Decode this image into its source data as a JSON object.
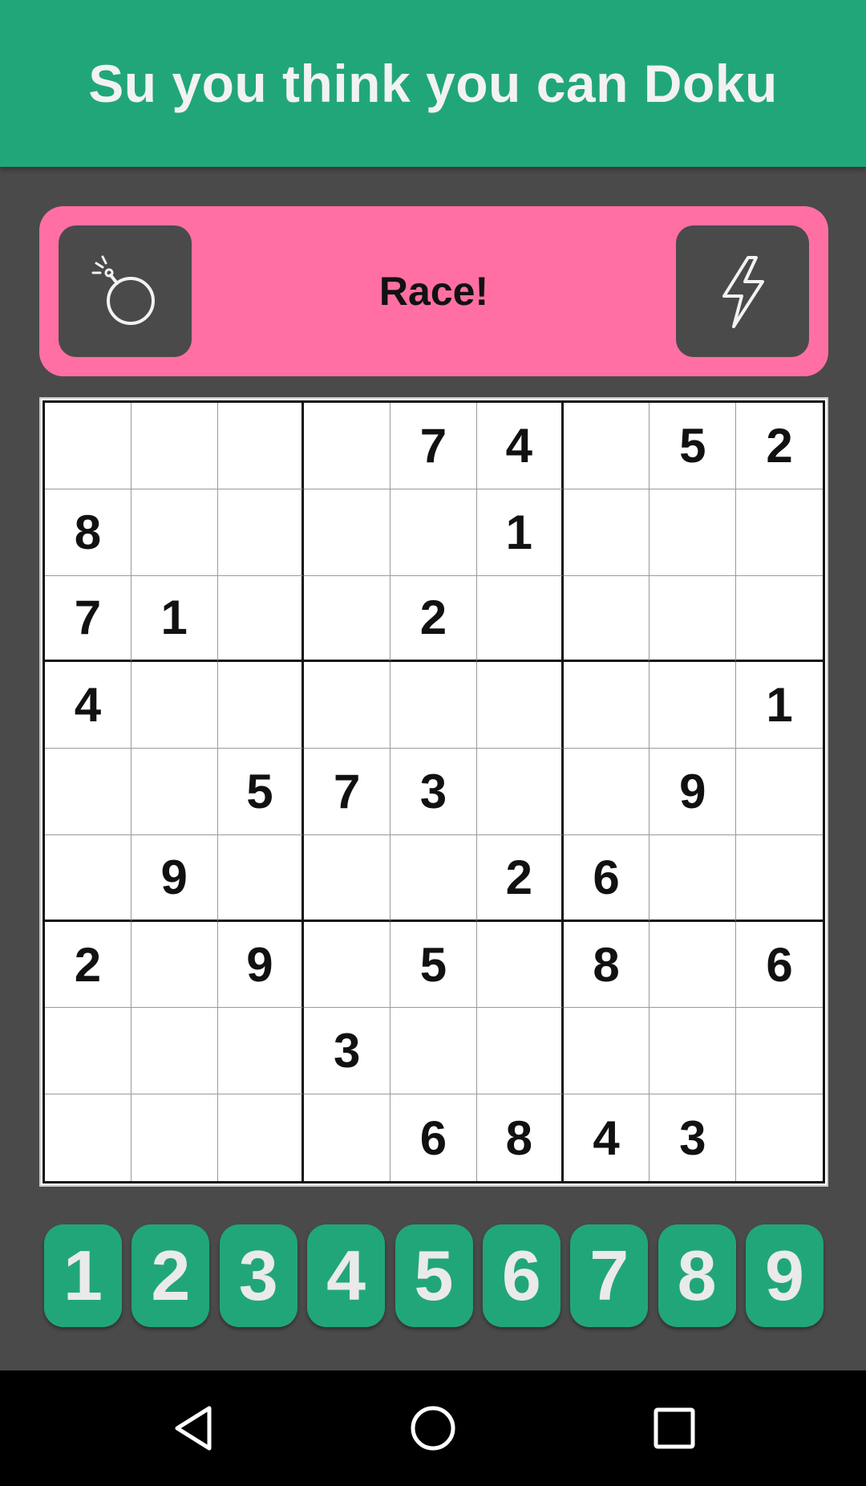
{
  "app": {
    "title": "Su you think you can Doku",
    "accent_color": "#21a67a",
    "mode_card_color": "#ff6fa3"
  },
  "mode_bar": {
    "label": "Race!",
    "left_icon": "bomb-icon",
    "right_icon": "lightning-icon"
  },
  "board": {
    "rows": [
      [
        "",
        "",
        "",
        "",
        "7",
        "4",
        "",
        "5",
        "2"
      ],
      [
        "8",
        "",
        "",
        "",
        "",
        "1",
        "",
        "",
        ""
      ],
      [
        "7",
        "1",
        "",
        "",
        "2",
        "",
        "",
        "",
        ""
      ],
      [
        "4",
        "",
        "",
        "",
        "",
        "",
        "",
        "",
        "1"
      ],
      [
        "",
        "",
        "5",
        "7",
        "3",
        "",
        "",
        "9",
        ""
      ],
      [
        "",
        "9",
        "",
        "",
        "",
        "2",
        "6",
        "",
        ""
      ],
      [
        "2",
        "",
        "9",
        "",
        "5",
        "",
        "8",
        "",
        "6"
      ],
      [
        "",
        "",
        "",
        "3",
        "",
        "",
        "",
        "",
        ""
      ],
      [
        "",
        "",
        "",
        "",
        "6",
        "8",
        "4",
        "3",
        ""
      ]
    ]
  },
  "keypad": {
    "keys": [
      "1",
      "2",
      "3",
      "4",
      "5",
      "6",
      "7",
      "8",
      "9"
    ]
  },
  "nav": {
    "icons": [
      "back-icon",
      "home-icon",
      "recents-icon"
    ]
  }
}
